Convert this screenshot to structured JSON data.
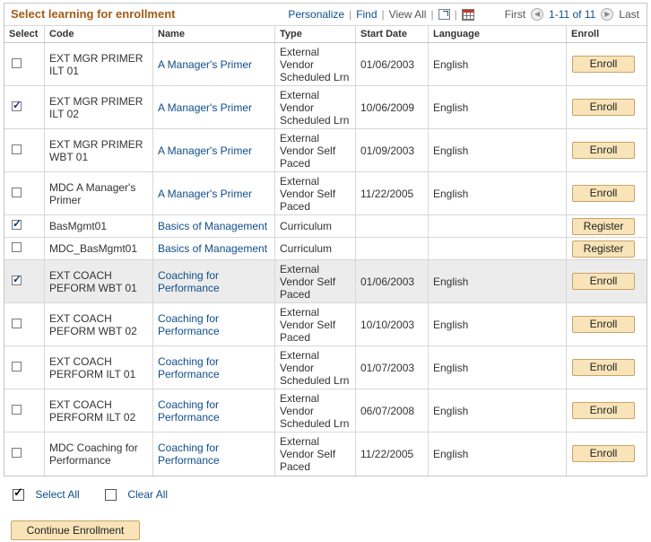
{
  "grid": {
    "title": "Select learning for enrollment",
    "nav": {
      "personalize": "Personalize",
      "find": "Find",
      "view_all": "View All",
      "first": "First",
      "range": "1-11 of 11",
      "last": "Last"
    },
    "columns": [
      "Select",
      "Code",
      "Name",
      "Type",
      "Start Date",
      "Language",
      "Enroll"
    ],
    "rows": [
      {
        "selected": false,
        "code": "EXT MGR PRIMER ILT 01",
        "name": "A Manager's Primer",
        "type": "External Vendor Scheduled Lrn",
        "start": "01/06/2003",
        "language": "English",
        "action": "Enroll"
      },
      {
        "selected": true,
        "code": "EXT MGR PRIMER ILT 02",
        "name": "A Manager's Primer",
        "type": "External Vendor Scheduled Lrn",
        "start": "10/06/2009",
        "language": "English",
        "action": "Enroll"
      },
      {
        "selected": false,
        "code": "EXT MGR PRIMER WBT 01",
        "name": "A Manager's Primer",
        "type": "External Vendor Self Paced",
        "start": "01/09/2003",
        "language": "English",
        "action": "Enroll"
      },
      {
        "selected": false,
        "code": "MDC A Manager's Primer",
        "name": "A Manager's Primer",
        "type": "External Vendor Self Paced",
        "start": "11/22/2005",
        "language": "English",
        "action": "Enroll"
      },
      {
        "selected": true,
        "code": "BasMgmt01",
        "name": "Basics of Management",
        "type": "Curriculum",
        "start": "",
        "language": "",
        "action": "Register"
      },
      {
        "selected": false,
        "code": "MDC_BasMgmt01",
        "name": "Basics of Management",
        "type": "Curriculum",
        "start": "",
        "language": "",
        "action": "Register"
      },
      {
        "selected": true,
        "code": "EXT COACH PEFORM WBT 01",
        "name": "Coaching for Performance",
        "type": "External Vendor Self Paced",
        "start": "01/06/2003",
        "language": "English",
        "action": "Enroll"
      },
      {
        "selected": false,
        "code": "EXT COACH PEFORM WBT 02",
        "name": "Coaching for Performance",
        "type": "External Vendor Self Paced",
        "start": "10/10/2003",
        "language": "English",
        "action": "Enroll"
      },
      {
        "selected": false,
        "code": "EXT COACH PERFORM ILT 01",
        "name": "Coaching for Performance",
        "type": "External Vendor Scheduled Lrn",
        "start": "01/07/2003",
        "language": "English",
        "action": "Enroll"
      },
      {
        "selected": false,
        "code": "EXT COACH PERFORM ILT 02",
        "name": "Coaching for Performance",
        "type": "External Vendor Scheduled Lrn",
        "start": "06/07/2008",
        "language": "English",
        "action": "Enroll"
      },
      {
        "selected": false,
        "code": "MDC Coaching for Performance",
        "name": "Coaching for Performance",
        "type": "External Vendor Self Paced",
        "start": "11/22/2005",
        "language": "English",
        "action": "Enroll"
      }
    ]
  },
  "footer": {
    "select_all": "Select All",
    "clear_all": "Clear All",
    "continue": "Continue Enrollment"
  },
  "icons": {
    "zoom": "zoom-icon",
    "download": "grid-download-icon",
    "prev": "previous-icon",
    "next": "next-icon"
  },
  "colors": {
    "title": "#a35b17",
    "link": "#104e8b",
    "button": "#f8e4b8"
  }
}
